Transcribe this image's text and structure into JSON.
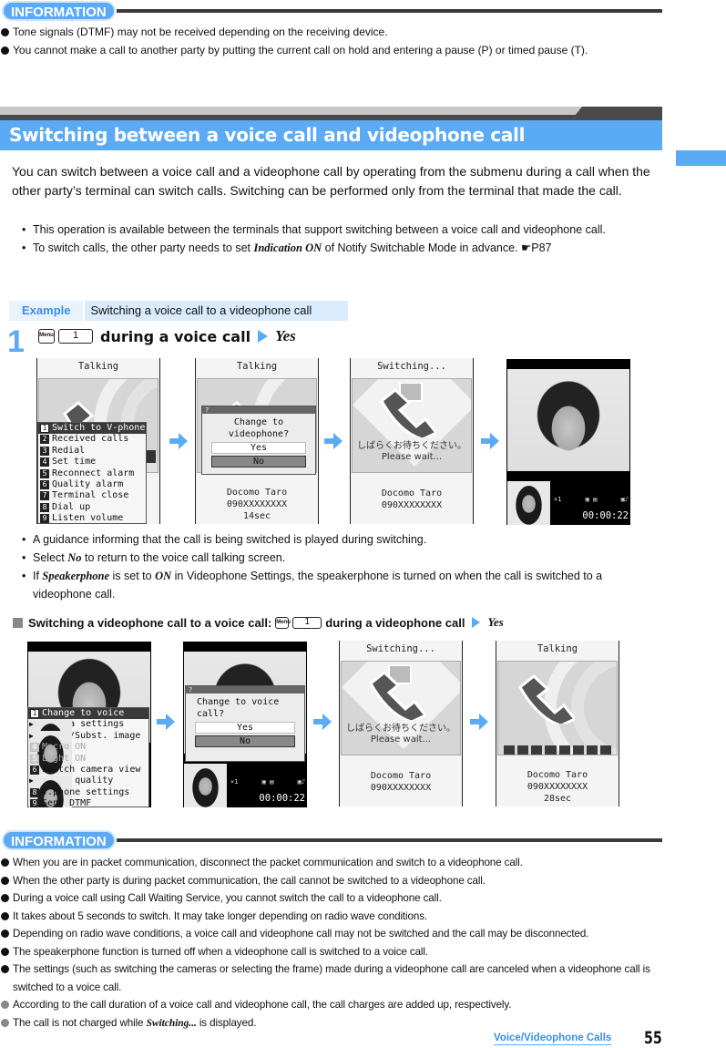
{
  "info_top": {
    "label": "INFORMATION",
    "items": [
      "Tone signals (DTMF) may not be received depending on the receiving device.",
      "You cannot make a call to another party by putting the current call on hold and entering a pause (P) or timed pause (T)."
    ]
  },
  "section": {
    "title": "Switching between a voice call and videophone call",
    "intro": "You can switch between a voice call and a videophone call by operating from the submenu during a call when the other party’s terminal can switch calls. Switching can be performed only from the terminal that made the call.",
    "bullets": [
      {
        "text": "This operation is available between the terminals that support switching between a voice call and videophone call."
      },
      {
        "pre": "To switch calls, the other party needs to set ",
        "em": "Indication ON",
        "post": " of Notify Switchable Mode in advance. ",
        "ref": "☛P87"
      }
    ]
  },
  "example": {
    "label": "Example",
    "text": "Switching a voice call to a videophone call"
  },
  "step1": {
    "number": "1",
    "menu_key": "Menu",
    "num_key": "1",
    "action": "during a voice call",
    "result": "Yes"
  },
  "screens_row1": {
    "s1": {
      "title": "Talking",
      "menu": [
        {
          "n": "1",
          "label": "Switch to V-phone",
          "selected": true
        },
        {
          "n": "2",
          "label": "Received calls"
        },
        {
          "n": "3",
          "label": "Redial"
        },
        {
          "n": "4",
          "label": "Set time"
        },
        {
          "n": "5",
          "label": "Reconnect alarm"
        },
        {
          "n": "6",
          "label": "Quality alarm"
        },
        {
          "n": "7",
          "label": "Terminal close"
        },
        {
          "n": "8",
          "label": "Dial up"
        },
        {
          "n": "9",
          "label": "Listen volume"
        }
      ]
    },
    "s2": {
      "title": "Talking",
      "dialog_mark": "?",
      "question1": "Change to",
      "question2": "videophone?",
      "yes": "Yes",
      "no": "No",
      "name": "Docomo Taro",
      "number": "090XXXXXXXX",
      "duration": "14sec"
    },
    "s3": {
      "title": "Switching...",
      "wait_jp": "しばらくお待ちください。",
      "wait_en": "Please wait...",
      "name": "Docomo Taro",
      "number": "090XXXXXXXX"
    },
    "s4": {
      "zoom": "×1",
      "timer": "00:00:22"
    }
  },
  "notes_step1": [
    {
      "text": "A guidance informing that the call is being switched is played during switching."
    },
    {
      "pre": "Select ",
      "em": "No",
      "post": " to return to the voice call talking screen."
    },
    {
      "pre": "If ",
      "em": "Speakerphone",
      "mid": " is set to ",
      "em2": "ON",
      "post": " in Videophone Settings, the speakerphone is turned on when the call is switched to a videophone call."
    }
  ],
  "sub_section": {
    "title": "Switching a videophone call to a voice call:",
    "menu_key": "Menu",
    "num_key": "1",
    "action": "during a videophone call",
    "result": "Yes"
  },
  "screens_row2": {
    "s1": {
      "menu": [
        {
          "n": "1",
          "label": "Change to voice",
          "selected": true
        },
        {
          "n": "2",
          "label": "Camera settings",
          "submenu": true
        },
        {
          "n": "3",
          "label": "Frame/Subst. image",
          "submenu": true
        },
        {
          "n": "4",
          "label": "Macro ON",
          "disabled": true
        },
        {
          "n": "5",
          "label": "Light ON",
          "disabled": true
        },
        {
          "n": "6",
          "label": "Switch camera view"
        },
        {
          "n": "7",
          "label": "Image quality",
          "submenu": true
        },
        {
          "n": "8",
          "label": "V.phone settings"
        },
        {
          "n": "9",
          "label": "Send DTMF"
        }
      ]
    },
    "s2": {
      "dialog_mark": "?",
      "question1": "Change to voice",
      "question2": "call?",
      "yes": "Yes",
      "no": "No",
      "zoom": "×1",
      "timer": "00:00:22"
    },
    "s3": {
      "title": "Switching...",
      "wait_jp": "しばらくお待ちください。",
      "wait_en": "Please wait...",
      "name": "Docomo Taro",
      "number": "090XXXXXXXX"
    },
    "s4": {
      "title": "Talking",
      "name": "Docomo Taro",
      "number": "090XXXXXXXX",
      "duration": "28sec"
    }
  },
  "info_bottom": {
    "label": "INFORMATION",
    "items": [
      {
        "text": "When you are in packet communication, disconnect the packet communication and switch to a videophone call."
      },
      {
        "text": "When the other party is during packet communication, the call cannot be switched to a videophone call."
      },
      {
        "text": "During a voice call using Call Waiting Service, you cannot switch the call to a videophone call."
      },
      {
        "text": "It takes about 5 seconds to switch. It may take longer depending on radio wave conditions."
      },
      {
        "text": "Depending on radio wave conditions, a voice call and videophone call may not be switched and the call may be disconnected."
      },
      {
        "text": "The speakerphone function is turned off when a videophone call is switched to a voice call."
      },
      {
        "text": "The settings (such as switching the cameras or selecting the frame) made during a videophone call are canceled when a videophone call is switched to a voice call."
      },
      {
        "text": "According to the call duration of a voice call and videophone call, the call charges are added up, respectively.",
        "grey": true
      },
      {
        "pre": "The call is not charged while ",
        "em": "Switching...",
        "post": " is displayed.",
        "grey": true
      }
    ]
  },
  "footer": {
    "chapter": "Voice/Videophone Calls",
    "page": "55"
  },
  "colors": {
    "accent": "#5aaaf4",
    "dark_rule": "#3a3a3a"
  }
}
